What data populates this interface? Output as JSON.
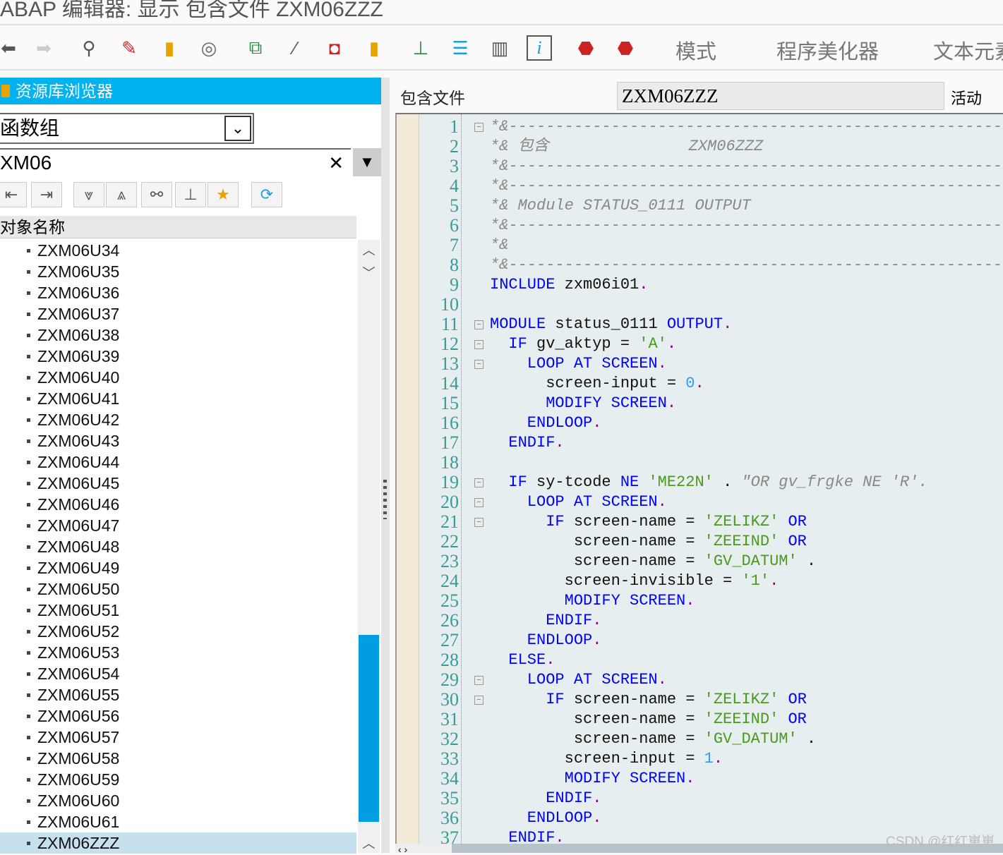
{
  "window": {
    "title": "ABAP 编辑器: 显示 包含文件 ZXM06ZZZ"
  },
  "toolbar": {
    "icons": [
      "back-icon",
      "forward-icon",
      "other-object-icon",
      "display-change-icon",
      "activate-icon",
      "where-used-icon",
      "object-list-icon",
      "magic-wand-icon",
      "breakpoint-icon",
      "navigate-icon",
      "hierarchy-icon",
      "stack-icon",
      "layout-icon",
      "info-icon",
      "stop-icon",
      "stop-user-icon"
    ],
    "mode_label": "模式",
    "pretty_printer_label": "程序美化器",
    "text_elements_label": "文本元素"
  },
  "repo": {
    "title": "资源库浏览器",
    "object_type": "函数组",
    "object_name": "XM06",
    "column_header": "对象名称",
    "items": [
      "ZXM06U34",
      "ZXM06U35",
      "ZXM06U36",
      "ZXM06U37",
      "ZXM06U38",
      "ZXM06U39",
      "ZXM06U40",
      "ZXM06U41",
      "ZXM06U42",
      "ZXM06U43",
      "ZXM06U44",
      "ZXM06U45",
      "ZXM06U46",
      "ZXM06U47",
      "ZXM06U48",
      "ZXM06U49",
      "ZXM06U50",
      "ZXM06U51",
      "ZXM06U52",
      "ZXM06U53",
      "ZXM06U54",
      "ZXM06U55",
      "ZXM06U56",
      "ZXM06U57",
      "ZXM06U58",
      "ZXM06U59",
      "ZXM06U60",
      "ZXM06U61",
      "ZXM06ZZZ"
    ],
    "selected": "ZXM06ZZZ",
    "scroll_accent": "#009de0"
  },
  "editor": {
    "include_label": "包含文件",
    "include_value": "ZXM06ZZZ",
    "status": "活动",
    "lines": [
      {
        "n": "1",
        "f": "-",
        "t": [
          [
            "c",
            "*&---------------------------------------------------------------"
          ]
        ]
      },
      {
        "n": "2",
        "t": [
          [
            "c",
            "*& 包含               ZXM06ZZZ"
          ]
        ]
      },
      {
        "n": "3",
        "t": [
          [
            "c",
            "*&---------------------------------------------------------------"
          ]
        ]
      },
      {
        "n": "4",
        "t": [
          [
            "c",
            "*&---------------------------------------------------------------"
          ]
        ]
      },
      {
        "n": "5",
        "t": [
          [
            "c",
            "*& Module STATUS_0111 OUTPUT"
          ]
        ]
      },
      {
        "n": "6",
        "t": [
          [
            "c",
            "*&---------------------------------------------------------------"
          ]
        ]
      },
      {
        "n": "7",
        "t": [
          [
            "c",
            "*&"
          ]
        ]
      },
      {
        "n": "8",
        "t": [
          [
            "c",
            "*&---------------------------------------------------------------"
          ]
        ]
      },
      {
        "n": "9",
        "t": [
          [
            "k",
            "INCLUDE"
          ],
          [
            "t",
            " zxm06i01"
          ],
          [
            "p",
            "."
          ]
        ]
      },
      {
        "n": "10",
        "t": []
      },
      {
        "n": "11",
        "f": "-",
        "t": [
          [
            "k",
            "MODULE"
          ],
          [
            "t",
            " status_0111 "
          ],
          [
            "k",
            "OUTPUT"
          ],
          [
            "p",
            "."
          ]
        ]
      },
      {
        "n": "12",
        "f": "-",
        "t": [
          [
            "k",
            "  IF"
          ],
          [
            "t",
            " gv_aktyp = "
          ],
          [
            "s",
            "'A'"
          ],
          [
            "p",
            "."
          ]
        ]
      },
      {
        "n": "13",
        "f": "-",
        "t": [
          [
            "k",
            "    LOOP AT SCREEN"
          ],
          [
            "p",
            "."
          ]
        ]
      },
      {
        "n": "14",
        "t": [
          [
            "t",
            "      screen-input = "
          ],
          [
            "n",
            "0"
          ],
          [
            "p",
            "."
          ]
        ]
      },
      {
        "n": "15",
        "t": [
          [
            "k",
            "      MODIFY SCREEN"
          ],
          [
            "p",
            "."
          ]
        ]
      },
      {
        "n": "16",
        "t": [
          [
            "k",
            "    ENDLOOP"
          ],
          [
            "p",
            "."
          ]
        ]
      },
      {
        "n": "17",
        "t": [
          [
            "k",
            "  ENDIF"
          ],
          [
            "p",
            "."
          ]
        ]
      },
      {
        "n": "18",
        "t": []
      },
      {
        "n": "19",
        "f": "-",
        "t": [
          [
            "k",
            "  IF"
          ],
          [
            "t",
            " sy-tcode "
          ],
          [
            "k",
            "NE"
          ],
          [
            "s",
            " 'ME22N'"
          ],
          [
            "t",
            " . "
          ],
          [
            "c",
            "\"OR gv_frgke NE 'R'."
          ]
        ]
      },
      {
        "n": "20",
        "f": "-",
        "t": [
          [
            "k",
            "    LOOP AT SCREEN"
          ],
          [
            "p",
            "."
          ]
        ]
      },
      {
        "n": "21",
        "f": "-",
        "t": [
          [
            "k",
            "      IF"
          ],
          [
            "t",
            " screen-name = "
          ],
          [
            "s",
            "'ZELIKZ'"
          ],
          [
            "k",
            " OR"
          ]
        ]
      },
      {
        "n": "22",
        "t": [
          [
            "t",
            "         screen-name = "
          ],
          [
            "s",
            "'ZEEIND'"
          ],
          [
            "k",
            " OR"
          ]
        ]
      },
      {
        "n": "23",
        "t": [
          [
            "t",
            "         screen-name = "
          ],
          [
            "s",
            "'GV_DATUM'"
          ],
          [
            "t",
            " ."
          ]
        ]
      },
      {
        "n": "24",
        "t": [
          [
            "t",
            "        screen-invisible = "
          ],
          [
            "s",
            "'1'"
          ],
          [
            "p",
            "."
          ]
        ]
      },
      {
        "n": "25",
        "t": [
          [
            "k",
            "        MODIFY SCREEN"
          ],
          [
            "p",
            "."
          ]
        ]
      },
      {
        "n": "26",
        "t": [
          [
            "k",
            "      ENDIF"
          ],
          [
            "p",
            "."
          ]
        ]
      },
      {
        "n": "27",
        "t": [
          [
            "k",
            "    ENDLOOP"
          ],
          [
            "p",
            "."
          ]
        ]
      },
      {
        "n": "28",
        "t": [
          [
            "k",
            "  ELSE"
          ],
          [
            "p",
            "."
          ]
        ]
      },
      {
        "n": "29",
        "f": "-",
        "t": [
          [
            "k",
            "    LOOP AT SCREEN"
          ],
          [
            "p",
            "."
          ]
        ]
      },
      {
        "n": "30",
        "f": "-",
        "t": [
          [
            "k",
            "      IF"
          ],
          [
            "t",
            " screen-name = "
          ],
          [
            "s",
            "'ZELIKZ'"
          ],
          [
            "k",
            " OR"
          ]
        ]
      },
      {
        "n": "31",
        "t": [
          [
            "t",
            "         screen-name = "
          ],
          [
            "s",
            "'ZEEIND'"
          ],
          [
            "k",
            " OR"
          ]
        ]
      },
      {
        "n": "32",
        "t": [
          [
            "t",
            "         screen-name = "
          ],
          [
            "s",
            "'GV_DATUM'"
          ],
          [
            "t",
            " ."
          ]
        ]
      },
      {
        "n": "33",
        "t": [
          [
            "t",
            "        screen-input = "
          ],
          [
            "n",
            "1"
          ],
          [
            "p",
            "."
          ]
        ]
      },
      {
        "n": "34",
        "t": [
          [
            "k",
            "        MODIFY SCREEN"
          ],
          [
            "p",
            "."
          ]
        ]
      },
      {
        "n": "35",
        "t": [
          [
            "k",
            "      ENDIF"
          ],
          [
            "p",
            "."
          ]
        ]
      },
      {
        "n": "36",
        "t": [
          [
            "k",
            "    ENDLOOP"
          ],
          [
            "p",
            "."
          ]
        ]
      },
      {
        "n": "37",
        "t": [
          [
            "k",
            "  ENDIF"
          ],
          [
            "p",
            "."
          ]
        ]
      }
    ]
  },
  "watermark": "CSDN @红红崽崽"
}
